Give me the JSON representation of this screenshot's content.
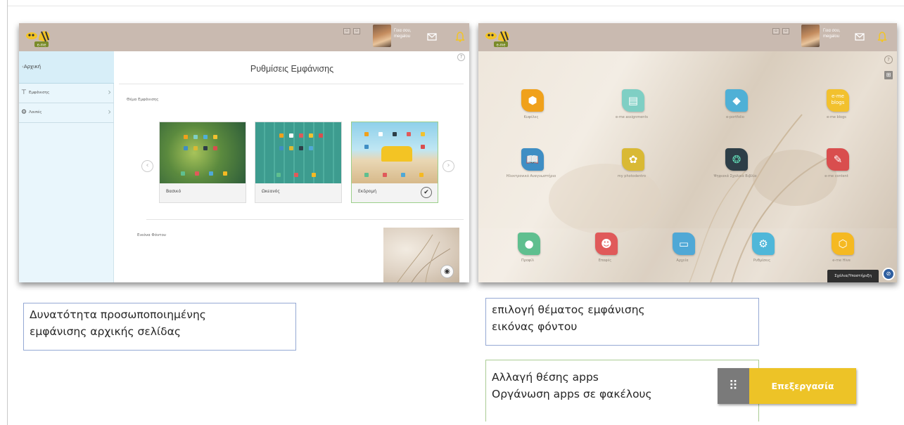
{
  "header": {
    "greeting": "Γεια σου, megalou",
    "logo_text": "e-me"
  },
  "left_window": {
    "back_label": "Αρχική",
    "page_title": "Ρυθμίσεις Εμφάνισης",
    "help": "?",
    "sidebar_items": [
      {
        "label": "Εμφάνισης",
        "icon": "brush-icon"
      },
      {
        "label": "Λοιπές",
        "icon": "gear-icon"
      }
    ],
    "theme_section_label": "Θέμα Εμφάνισης",
    "themes": [
      {
        "name": "Βασικό",
        "selected": false
      },
      {
        "name": "Ωκεανός",
        "selected": false
      },
      {
        "name": "Εκδρομή",
        "selected": true
      }
    ],
    "background_section_label": "Εικόνα Φόντου"
  },
  "right_window": {
    "help": "?",
    "apps": [
      {
        "name": "Κυψέλες",
        "color": "#f0a11b",
        "icon": "hexagon-icon"
      },
      {
        "name": "e-me assignments",
        "color": "#7fcfc4",
        "icon": "clipboard-icon"
      },
      {
        "name": "e-portfolio",
        "color": "#4fb0d6",
        "icon": "diamond-icon"
      },
      {
        "name": "e-me blogs",
        "color": "#f2c12e",
        "icon": "blog-icon"
      },
      {
        "name": "Ηλεκτρονικό Αναγνωστήριο",
        "color": "#3f8ec4",
        "icon": "book-icon"
      },
      {
        "name": "my photodentro",
        "color": "#d9b934",
        "icon": "photodentro-icon"
      },
      {
        "name": "Ψηφιακά Σχολικά Βιβλία",
        "color": "#2d3e47",
        "icon": "dsb-icon"
      },
      {
        "name": "e-me content",
        "color": "#d94e4e",
        "icon": "edit-note-icon"
      },
      {
        "name": "Προφίλ",
        "color": "#5fbf8f",
        "icon": "person-icon"
      },
      {
        "name": "Επαφές",
        "color": "#e05a5a",
        "icon": "people-icon"
      },
      {
        "name": "Αρχεία",
        "color": "#4fa8d6",
        "icon": "folder-icon"
      },
      {
        "name": "Ρυθμίσεις",
        "color": "#4fb7d9",
        "icon": "gear-icon"
      },
      {
        "name": "e-me Hive",
        "color": "#f5b922",
        "icon": "honeycomb-icon"
      }
    ],
    "help_pill": "Σχόλια/Υποστήριξη"
  },
  "captions": {
    "customization_line1": "Δυνατότητα προσωποποιημένης",
    "customization_line2": "εμφάνισης αρχικής σελίδας",
    "theme_line1": "επιλογή θέματος εμφάνισης",
    "theme_line2": "εικόνας φόντου",
    "apps_line1": "Αλλαγή θέσης apps",
    "apps_line2": "Οργάνωση apps σε φακέλους"
  },
  "edit_button": {
    "label": "Επεξεργασία"
  }
}
